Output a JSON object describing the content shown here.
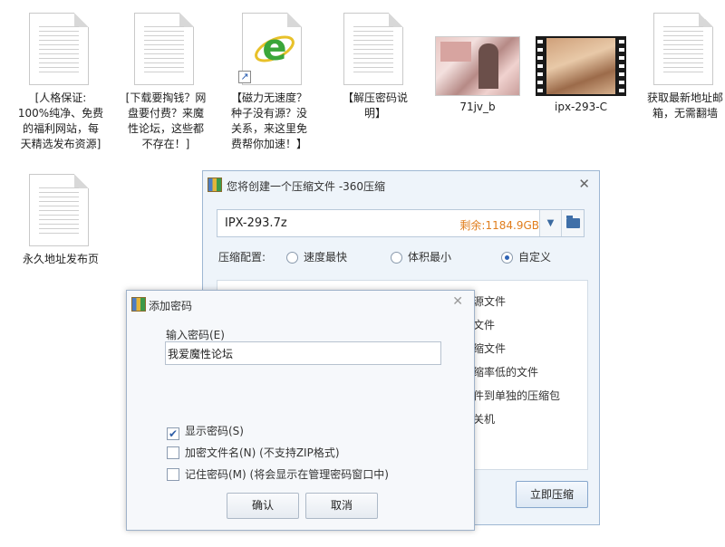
{
  "desktop": {
    "files": [
      {
        "label": "[人格保证:\n100%纯净、免费\n的福利网站，每\n天精选发布资源]",
        "icon": "document-icon"
      },
      {
        "label": "[下载要掏钱？网\n盘要付费？来魔\n性论坛，这些都\n不存在！]",
        "icon": "document-icon"
      },
      {
        "label": "【磁力无速度？\n种子没有源？没\n关系，来这里免\n费帮你加速！】",
        "icon": "ie-shortcut-icon"
      },
      {
        "label": "【解压密码说\n明】",
        "icon": "document-icon"
      },
      {
        "label": "71jv_b",
        "icon": "image-thumbnail-icon"
      },
      {
        "label": "ipx-293-C",
        "icon": "video-thumbnail-icon"
      },
      {
        "label": "获取最新地址邮\n箱，无需翻墙",
        "icon": "document-icon"
      },
      {
        "label": "永久地址发布页",
        "icon": "document-icon"
      }
    ]
  },
  "compress_dialog": {
    "title": "您将创建一个压缩文件 -360压缩",
    "close_label": "✕",
    "filename": "IPX-293.7z",
    "free_space": "剩余:1184.9GB",
    "config_label": "压缩配置:",
    "config_options": [
      "速度最快",
      "体积最小",
      "自定义"
    ],
    "selected_option": "自定义",
    "options_visible": [
      "源文件",
      "文件",
      "缩文件",
      "缩率低的文件",
      "件到单独的压缩包",
      "关机"
    ],
    "compress_button": "立即压缩"
  },
  "password_dialog": {
    "title": "添加密码",
    "close_label": "✕",
    "input_label": "输入密码(E)",
    "password_value": "我爱魔性论坛",
    "checkboxes": [
      {
        "label": "显示密码(S)",
        "checked": true
      },
      {
        "label": "加密文件名(N) (不支持ZIP格式)",
        "checked": false
      },
      {
        "label": "记住密码(M) (将会显示在管理密码窗口中)",
        "checked": false
      }
    ],
    "ok_button": "确认",
    "cancel_button": "取消"
  },
  "colors": {
    "accent": "#2e63b5",
    "free_space": "#e07d1c",
    "ie_green": "#3aa63a"
  }
}
